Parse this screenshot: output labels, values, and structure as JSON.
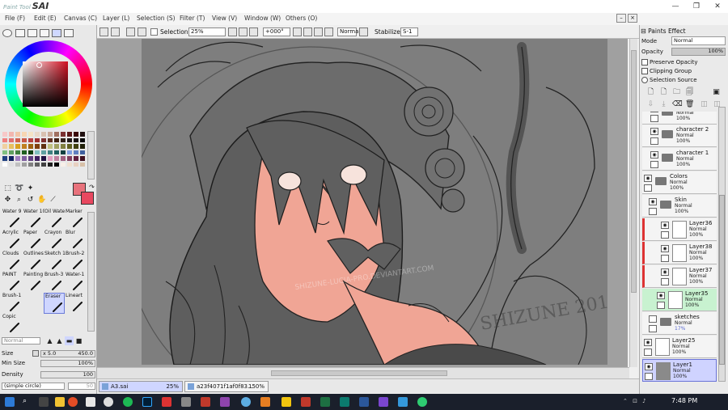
{
  "app": {
    "logo_small": "Paint Tool",
    "logo_big": "SAI"
  },
  "window_controls": {
    "minimize": "—",
    "restore": "❐",
    "close": "✕"
  },
  "menu": [
    {
      "label": "File (F)"
    },
    {
      "label": "Edit (E)"
    },
    {
      "label": "Canvas (C)"
    },
    {
      "label": "Layer (L)"
    },
    {
      "label": "Selection (S)"
    },
    {
      "label": "Filter (T)"
    },
    {
      "label": "View (V)"
    },
    {
      "label": "Window (W)"
    },
    {
      "label": "Others (O)"
    }
  ],
  "toolbar": {
    "selection_label": "Selection",
    "zoom": "25%",
    "rotation": "+000°",
    "blend_mode": "Normal",
    "stabilizer_label": "Stabilizer",
    "stabilizer_value": "S-1"
  },
  "colors": {
    "primary": "#e8727c",
    "secondary": "#e84860",
    "swatches": [
      "#f7c8c8",
      "#f3b6ae",
      "#f2c5a8",
      "#f7d6b2",
      "#f5e3c5",
      "#e8d8c8",
      "#d8c0b0",
      "#c8a898",
      "#a07060",
      "#7a3030",
      "#5a1818",
      "#3a0808",
      "#201010",
      "#f08080",
      "#e07070",
      "#d06050",
      "#c85848",
      "#b84040",
      "#a03030",
      "#803030",
      "#603020",
      "#402010",
      "#302018",
      "#201818",
      "#181010",
      "#080808",
      "#f0d0a0",
      "#e8c060",
      "#d8a020",
      "#c08020",
      "#a06010",
      "#804010",
      "#603010",
      "#c0c080",
      "#a0a060",
      "#808040",
      "#606020",
      "#404010",
      "#202008",
      "#80c080",
      "#60a060",
      "#408040",
      "#206020",
      "#104010",
      "#80c0c0",
      "#60a0a0",
      "#408080",
      "#206060",
      "#104040",
      "#80a0e0",
      "#6080c0",
      "#4060a0",
      "#204080",
      "#102060",
      "#a080c0",
      "#8060a0",
      "#604080",
      "#402060",
      "#201040",
      "#e0a0c0",
      "#c080a0",
      "#a06080",
      "#804060",
      "#602040",
      "#401020",
      "#ffffff",
      "#e0e0e0",
      "#c0c0c0",
      "#a0a0a0",
      "#808080",
      "#606060",
      "#404040",
      "#202020",
      "#000000",
      "#f8f0e8",
      "#f0e0d0",
      "#e8d0c0",
      "#d8c0a8"
    ]
  },
  "brushes": [
    {
      "name": "Water 9"
    },
    {
      "name": "Water 10"
    },
    {
      "name": "Oil Wate"
    },
    {
      "name": "Marker"
    },
    {
      "name": "Acrylic"
    },
    {
      "name": "Paper"
    },
    {
      "name": "Crayon"
    },
    {
      "name": "Blur"
    },
    {
      "name": "Clouds"
    },
    {
      "name": "Outlines"
    },
    {
      "name": "Sketch 1"
    },
    {
      "name": "Brush-2"
    },
    {
      "name": "PAINT"
    },
    {
      "name": "Painting"
    },
    {
      "name": "Brush-3"
    },
    {
      "name": "Water-1"
    },
    {
      "name": "Brush-1"
    },
    {
      "name": ""
    },
    {
      "name": "Eraser"
    },
    {
      "name": "Lineart"
    },
    {
      "name": "Copic"
    },
    {
      "name": ""
    },
    {
      "name": ""
    },
    {
      "name": ""
    }
  ],
  "brush_settings": {
    "mode": "Normal",
    "size_label": "Size",
    "size_multiplier": "x 5.0",
    "size_value": "450.0",
    "min_size_label": "Min Size",
    "min_size_value": "100%",
    "density_label": "Density",
    "density_value": "100",
    "shape": "(simple circle)",
    "shape_value": "50"
  },
  "right_panel": {
    "paints_effect": "Paints Effect",
    "mode_label": "Mode",
    "mode_value": "Normal",
    "opacity_label": "Opacity",
    "opacity_value": "100%",
    "preserve_opacity": "Preserve Opacity",
    "clipping_group": "Clipping Group",
    "selection_source": "Selection Source"
  },
  "layers": [
    {
      "name": "",
      "mode": "Normal",
      "opacity": "100%",
      "kind": "folder"
    },
    {
      "name": "character 2",
      "mode": "Normal",
      "opacity": "100%",
      "kind": "folder"
    },
    {
      "name": "character 1",
      "mode": "Normal",
      "opacity": "100%",
      "kind": "folder"
    },
    {
      "name": "Colors",
      "mode": "Normal",
      "opacity": "100%",
      "kind": "folder"
    },
    {
      "name": "Skin",
      "mode": "Normal",
      "opacity": "100%",
      "kind": "folder"
    },
    {
      "name": "Layer36",
      "mode": "Normal",
      "opacity": "100%",
      "kind": "layer"
    },
    {
      "name": "Layer38",
      "mode": "Normal",
      "opacity": "100%",
      "kind": "layer"
    },
    {
      "name": "Layer37",
      "mode": "Normal",
      "opacity": "100%",
      "kind": "layer"
    },
    {
      "name": "Layer35",
      "mode": "Normal",
      "opacity": "100%",
      "kind": "layer"
    },
    {
      "name": "sketches",
      "mode": "Normal",
      "opacity": "17%",
      "kind": "folder"
    },
    {
      "name": "Layer25",
      "mode": "Normal",
      "opacity": "100%",
      "kind": "layer"
    },
    {
      "name": "Layer1",
      "mode": "Normal",
      "opacity": "100%",
      "kind": "layer"
    }
  ],
  "canvas": {
    "watermark": "SHIZUNE-LUCIA-PRO.DEVIANTART.COM",
    "signature": "SHIZUNE 2014"
  },
  "doc_tabs": [
    {
      "name": "A3.sai",
      "zoom": "25%"
    },
    {
      "name": "a23f4071f1af0f83...",
      "zoom": "150%"
    }
  ],
  "taskbar": {
    "time": "7:48 PM",
    "tray": "⌃ ⊡ ♪"
  }
}
